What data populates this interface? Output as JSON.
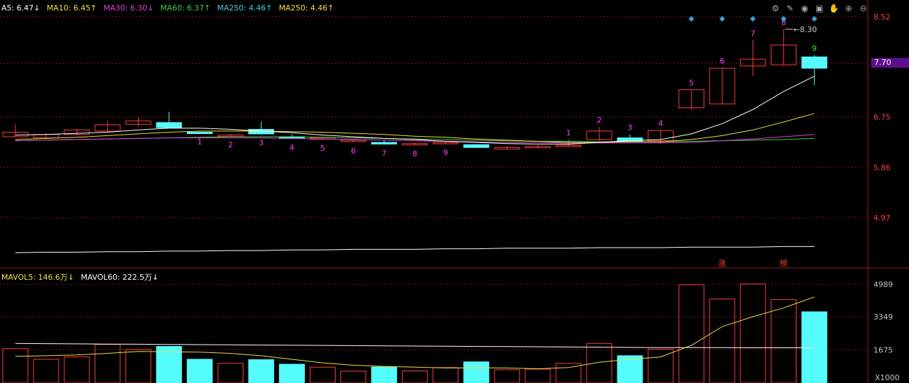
{
  "legend_price": [
    {
      "text": "A5: 6.47↓",
      "color": "#ffffff"
    },
    {
      "text": "MA10: 6.45↑",
      "color": "#f0e040"
    },
    {
      "text": "MA30: 6.30↓",
      "color": "#e040e0"
    },
    {
      "text": "MA60: 6.37↑",
      "color": "#40d040"
    },
    {
      "text": "MA250: 4.46↑",
      "color": "#40d0e0"
    },
    {
      "text": "MA250: 4.46↑",
      "color": "#f0e040"
    }
  ],
  "legend_volume": [
    {
      "text": "MAVOL5: 146.6万↓",
      "color": "#f0e040"
    },
    {
      "text": "MAVOL60: 222.5万↓",
      "color": "#ffffff"
    }
  ],
  "toolbar_icons": [
    "gear-icon",
    "pen-icon",
    "eye-icon",
    "save-icon",
    "hand-icon",
    "zoom-in-icon",
    "zoom-out-icon"
  ],
  "current_price_tag": "7.70",
  "colors": {
    "up": "#ff3c3c",
    "down": "#54fcfc",
    "grid": "#7a1a1a",
    "axis": "#ff3c3c",
    "count": "#ff3cff",
    "vol_axis": "#c0c0c0"
  },
  "chart_data": {
    "type": "candlestick",
    "price_axis": {
      "ticks": [
        "8.52",
        "7.70",
        "6.75",
        "5.86",
        "4.97"
      ]
    },
    "volume_axis": {
      "ticks": [
        "4989",
        "3349",
        "1675"
      ],
      "unit_label": "X1000"
    },
    "candles": [
      {
        "o": 6.4,
        "c": 6.48,
        "h": 6.62,
        "l": 6.4
      },
      {
        "o": 6.38,
        "c": 6.44,
        "h": 6.46,
        "l": 6.36
      },
      {
        "o": 6.44,
        "c": 6.52,
        "h": 6.54,
        "l": 6.42
      },
      {
        "o": 6.5,
        "c": 6.61,
        "h": 6.68,
        "l": 6.48
      },
      {
        "o": 6.62,
        "c": 6.68,
        "h": 6.75,
        "l": 6.58
      },
      {
        "o": 6.65,
        "c": 6.56,
        "h": 6.84,
        "l": 6.55
      },
      {
        "o": 6.48,
        "c": 6.47,
        "h": 6.49,
        "l": 6.46
      },
      {
        "o": 6.42,
        "c": 6.43,
        "h": 6.45,
        "l": 6.41
      },
      {
        "o": 6.53,
        "c": 6.45,
        "h": 6.67,
        "l": 6.44
      },
      {
        "o": 6.4,
        "c": 6.37,
        "h": 6.44,
        "l": 6.36
      },
      {
        "o": 6.37,
        "c": 6.38,
        "h": 6.4,
        "l": 6.35
      },
      {
        "o": 6.33,
        "c": 6.34,
        "h": 6.36,
        "l": 6.3
      },
      {
        "o": 6.3,
        "c": 6.27,
        "h": 6.34,
        "l": 6.26
      },
      {
        "o": 6.27,
        "c": 6.28,
        "h": 6.3,
        "l": 6.25
      },
      {
        "o": 6.29,
        "c": 6.3,
        "h": 6.31,
        "l": 6.27
      },
      {
        "o": 6.26,
        "c": 6.21,
        "h": 6.27,
        "l": 6.2
      },
      {
        "o": 6.18,
        "c": 6.21,
        "h": 6.24,
        "l": 6.17
      },
      {
        "o": 6.21,
        "c": 6.23,
        "h": 6.25,
        "l": 6.2
      },
      {
        "o": 6.24,
        "c": 6.25,
        "h": 6.35,
        "l": 6.24
      },
      {
        "o": 6.35,
        "c": 6.5,
        "h": 6.57,
        "l": 6.33
      },
      {
        "o": 6.38,
        "c": 6.32,
        "h": 6.44,
        "l": 6.3
      },
      {
        "o": 6.33,
        "c": 6.51,
        "h": 6.52,
        "l": 6.27
      },
      {
        "o": 6.91,
        "c": 7.23,
        "h": 7.23,
        "l": 6.88
      },
      {
        "o": 6.98,
        "c": 7.61,
        "h": 7.62,
        "l": 6.98
      },
      {
        "o": 7.65,
        "c": 7.77,
        "h": 8.11,
        "l": 7.47
      },
      {
        "o": 7.67,
        "c": 8.02,
        "h": 8.3,
        "l": 7.67
      },
      {
        "o": 7.81,
        "c": 7.61,
        "h": 7.84,
        "l": 7.31
      }
    ],
    "count_labels": [
      {
        "i": 6,
        "t": "1",
        "pos": "below"
      },
      {
        "i": 7,
        "t": "2",
        "pos": "below"
      },
      {
        "i": 8,
        "t": "3",
        "pos": "below"
      },
      {
        "i": 9,
        "t": "4",
        "pos": "below"
      },
      {
        "i": 10,
        "t": "5",
        "pos": "below"
      },
      {
        "i": 11,
        "t": "6",
        "pos": "below"
      },
      {
        "i": 12,
        "t": "7",
        "pos": "below"
      },
      {
        "i": 13,
        "t": "8",
        "pos": "below"
      },
      {
        "i": 14,
        "t": "9",
        "pos": "below"
      },
      {
        "i": 18,
        "t": "1",
        "pos": "above"
      },
      {
        "i": 19,
        "t": "2",
        "pos": "above"
      },
      {
        "i": 20,
        "t": "3",
        "pos": "above"
      },
      {
        "i": 21,
        "t": "4",
        "pos": "above"
      },
      {
        "i": 22,
        "t": "5",
        "pos": "above"
      },
      {
        "i": 23,
        "t": "6",
        "pos": "above"
      },
      {
        "i": 24,
        "t": "7",
        "pos": "above"
      },
      {
        "i": 25,
        "t": "8",
        "pos": "above"
      },
      {
        "i": 26,
        "t": "9",
        "pos": "above",
        "highlight": true
      }
    ],
    "high_marker": {
      "i": 25,
      "text": "8.30"
    },
    "signal_diamonds": [
      22,
      23,
      24,
      25,
      26
    ],
    "event_labels": [
      {
        "i": 23,
        "text": "涨"
      },
      {
        "i": 25,
        "text": "榜"
      }
    ],
    "ma5": [
      6.43,
      6.44,
      6.46,
      6.48,
      6.52,
      6.55,
      6.55,
      6.53,
      6.5,
      6.47,
      6.43,
      6.4,
      6.37,
      6.35,
      6.32,
      6.3,
      6.28,
      6.27,
      6.27,
      6.3,
      6.33,
      6.35,
      6.45,
      6.63,
      6.88,
      7.2,
      7.47
    ],
    "ma10": [
      6.35,
      6.37,
      6.39,
      6.42,
      6.45,
      6.48,
      6.5,
      6.5,
      6.5,
      6.49,
      6.48,
      6.46,
      6.44,
      6.41,
      6.39,
      6.36,
      6.34,
      6.32,
      6.3,
      6.3,
      6.31,
      6.31,
      6.35,
      6.42,
      6.52,
      6.66,
      6.81
    ],
    "ma30": [
      6.33,
      6.34,
      6.35,
      6.36,
      6.37,
      6.38,
      6.38,
      6.38,
      6.38,
      6.37,
      6.36,
      6.35,
      6.34,
      6.33,
      6.32,
      6.31,
      6.3,
      6.3,
      6.29,
      6.29,
      6.29,
      6.29,
      6.3,
      6.33,
      6.36,
      6.4,
      6.44
    ],
    "ma60": [
      6.33,
      6.34,
      6.35,
      6.36,
      6.37,
      6.38,
      6.39,
      6.4,
      6.4,
      6.4,
      6.39,
      6.38,
      6.37,
      6.36,
      6.35,
      6.34,
      6.33,
      6.32,
      6.32,
      6.31,
      6.31,
      6.31,
      6.32,
      6.33,
      6.34,
      6.35,
      6.37
    ],
    "ma250": [
      4.35,
      4.36,
      4.36,
      4.37,
      4.37,
      4.38,
      4.38,
      4.39,
      4.39,
      4.4,
      4.4,
      4.41,
      4.41,
      4.41,
      4.42,
      4.42,
      4.43,
      4.43,
      4.43,
      4.44,
      4.44,
      4.44,
      4.45,
      4.45,
      4.45,
      4.46,
      4.46
    ],
    "volumes": [
      1750,
      1200,
      1320,
      1950,
      1700,
      1850,
      1200,
      1000,
      1180,
      950,
      800,
      600,
      810,
      610,
      780,
      1070,
      670,
      700,
      990,
      2000,
      1380,
      1710,
      4970,
      4250,
      5010,
      4220,
      3600
    ],
    "mavol5": [
      1350,
      1380,
      1420,
      1500,
      1600,
      1580,
      1560,
      1500,
      1380,
      1200,
      1020,
      900,
      840,
      800,
      760,
      770,
      760,
      720,
      780,
      1050,
      1200,
      1320,
      1900,
      2850,
      3350,
      3800,
      4350
    ],
    "mavol60": [
      2000,
      1990,
      1980,
      1970,
      1960,
      1950,
      1940,
      1930,
      1920,
      1910,
      1900,
      1890,
      1880,
      1870,
      1860,
      1850,
      1840,
      1830,
      1820,
      1810,
      1800,
      1790,
      1790,
      1790,
      1780,
      1780,
      1780
    ]
  }
}
